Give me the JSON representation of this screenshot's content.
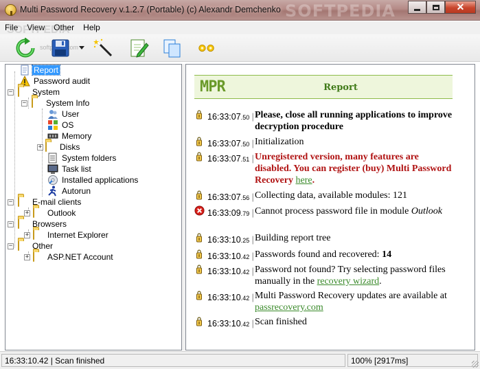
{
  "window": {
    "title": "Multi Password Recovery v.1.2.7 (Portable) (c) Alexandr Demchenko",
    "watermark": "SOFTPEDIA",
    "buttons": [
      "minimize",
      "maximize",
      "close"
    ]
  },
  "menu": {
    "items": [
      "File",
      "View",
      "Other",
      "Help"
    ],
    "watermark": "SOFTPEDIA"
  },
  "toolbar": {
    "buttons": [
      "refresh-icon",
      "save-icon",
      "dropdown-caret",
      "magic-wand-icon",
      "edit-icon",
      "copy-icon",
      "settings-icon"
    ],
    "watermark": "softpedia.com"
  },
  "tree": {
    "items": [
      {
        "label": "Report",
        "icon": "report-icon",
        "selected": true
      },
      {
        "label": "Password audit",
        "icon": "warning-icon"
      },
      {
        "label": "System",
        "icon": "folder-icon"
      },
      {
        "label": "System Info",
        "icon": "folder-icon"
      },
      {
        "label": "User",
        "icon": "user-icon"
      },
      {
        "label": "OS",
        "icon": "os-icon"
      },
      {
        "label": "Memory",
        "icon": "memory-icon"
      },
      {
        "label": "Disks",
        "icon": "folder-icon"
      },
      {
        "label": "System folders",
        "icon": "system-folders-icon"
      },
      {
        "label": "Task list",
        "icon": "task-list-icon"
      },
      {
        "label": "Installed applications",
        "icon": "installed-applications-icon"
      },
      {
        "label": "Autorun",
        "icon": "autorun-icon"
      },
      {
        "label": "E-mail clients",
        "icon": "folder-icon"
      },
      {
        "label": "Outlook",
        "icon": "folder-icon"
      },
      {
        "label": "Browsers",
        "icon": "folder-icon"
      },
      {
        "label": "Internet Explorer",
        "icon": "folder-icon"
      },
      {
        "label": "Other",
        "icon": "folder-icon"
      },
      {
        "label": "ASP.NET Account",
        "icon": "folder-icon"
      }
    ]
  },
  "report": {
    "logo": "MPR",
    "title": "Report",
    "entries": [
      {
        "time": "16:33:07",
        "ms": "50",
        "icon": "lock-icon",
        "parts": [
          {
            "t": "Please, close all running applications to improve decryption procedure",
            "s": "bold"
          }
        ]
      },
      {
        "time": "16:33:07",
        "ms": "50",
        "icon": "lock-icon",
        "parts": [
          {
            "t": "Initialization",
            "s": ""
          }
        ]
      },
      {
        "time": "16:33:07",
        "ms": "51",
        "icon": "lock-icon",
        "parts": [
          {
            "t": "Unregistered version, many features are disabled. You can register (buy) Multi Password Recovery ",
            "s": "red"
          },
          {
            "t": "here",
            "s": "link"
          },
          {
            "t": ".",
            "s": "red"
          }
        ]
      },
      {
        "time": "16:33:07",
        "ms": "56",
        "icon": "lock-icon",
        "parts": [
          {
            "t": "Collecting data, available modules: 121",
            "s": ""
          }
        ]
      },
      {
        "time": "16:33:09",
        "ms": "79",
        "icon": "error-icon",
        "parts": [
          {
            "t": "Cannot process password file in module ",
            "s": ""
          },
          {
            "t": "Outlook",
            "s": "italic"
          }
        ]
      },
      {
        "time": "16:33:10",
        "ms": "25",
        "icon": "lock-icon",
        "parts": [
          {
            "t": "Building report tree",
            "s": ""
          }
        ]
      },
      {
        "time": "16:33:10",
        "ms": "42",
        "icon": "lock-icon",
        "parts": [
          {
            "t": "Passwords found and recovered: ",
            "s": ""
          },
          {
            "t": "14",
            "s": "bold"
          }
        ]
      },
      {
        "time": "16:33:10",
        "ms": "42",
        "icon": "lock-icon",
        "parts": [
          {
            "t": "Password not found? Try selecting password files manually in the ",
            "s": ""
          },
          {
            "t": "recovery wizard",
            "s": "link"
          },
          {
            "t": ".",
            "s": ""
          }
        ]
      },
      {
        "time": "16:33:10",
        "ms": "42",
        "icon": "lock-icon",
        "parts": [
          {
            "t": "Multi Password Recovery updates are available at ",
            "s": ""
          },
          {
            "t": "passrecovery.com",
            "s": "link"
          }
        ]
      },
      {
        "time": "16:33:10",
        "ms": "42",
        "icon": "lock-icon",
        "parts": [
          {
            "t": "Scan finished",
            "s": ""
          }
        ]
      }
    ]
  },
  "status": {
    "left": "16:33:10.42 | Scan finished",
    "right": "100% [2917ms]"
  }
}
